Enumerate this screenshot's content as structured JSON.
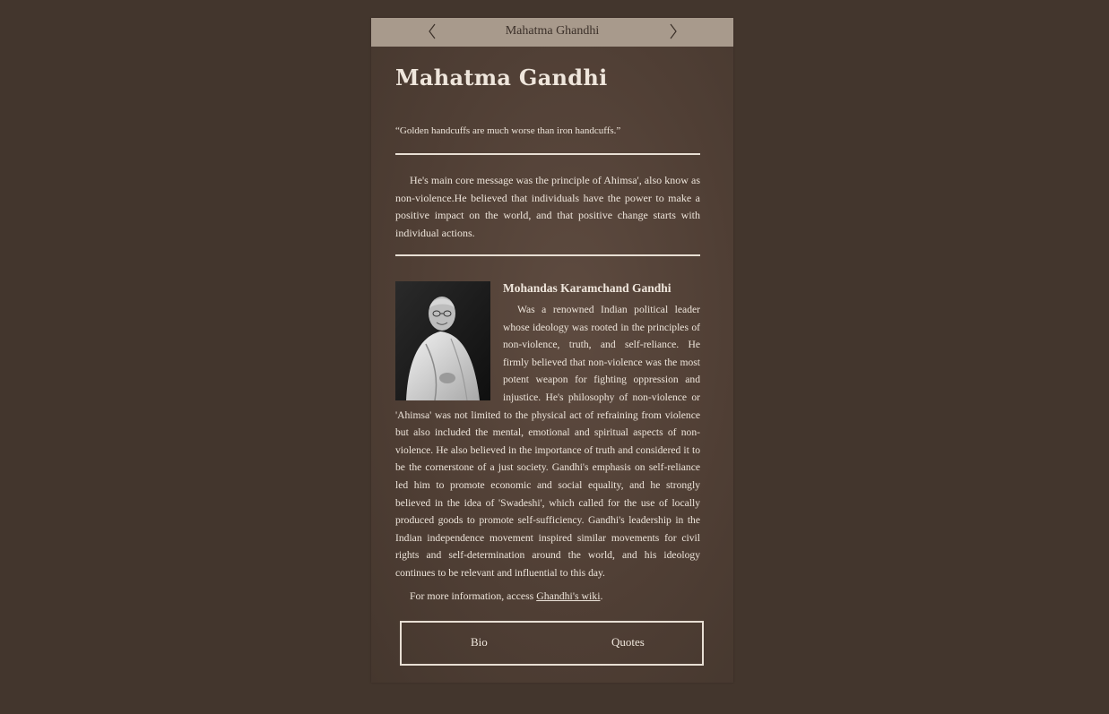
{
  "header": {
    "title": "Mahatma Ghandhi",
    "prev_icon": "chevron-left-icon",
    "next_icon": "chevron-right-icon"
  },
  "main": {
    "heading": "Mahatma Gandhi",
    "quote": "“Golden handcuffs are much worse than iron handcuffs.”",
    "intro": "He's main core message was the principle of Ahimsa', also know as non-violence.He believed that individuals have the power to make a positive impact on the world, and that positive change starts with individual actions.",
    "bio_name": "Mohandas Karamchand Gandhi",
    "bio_text": "Was a renowned Indian political leader whose ideology was rooted in the principles of non-violence, truth, and self-reliance. He firmly believed that non-violence was the most potent weapon for fighting oppression and injustice. He's philosophy of non-violence or 'Ahimsa' was not limited to the physical act of refraining from violence but also included the mental, emotional and spiritual aspects of non-violence. He also believed in the importance of truth and considered it to be the cornerstone of a just society. Gandhi's emphasis on self-reliance led him to promote economic and social equality, and he strongly believed in the idea of 'Swadeshi', which called for the use of locally produced goods to promote self-sufficiency. Gandhi's leadership in the Indian independence movement inspired similar movements for civil rights and self-determination around the world, and his ideology continues to be relevant and influential to this day.",
    "more_info_prefix": "For more information, access ",
    "more_info_link": "Ghandhi's wiki",
    "more_info_suffix": "."
  },
  "tabs": [
    {
      "label": "Bio"
    },
    {
      "label": "Quotes"
    }
  ],
  "colors": {
    "page_background": "#43362d",
    "topbar": "#a89a8c",
    "text": "#ede4da"
  }
}
